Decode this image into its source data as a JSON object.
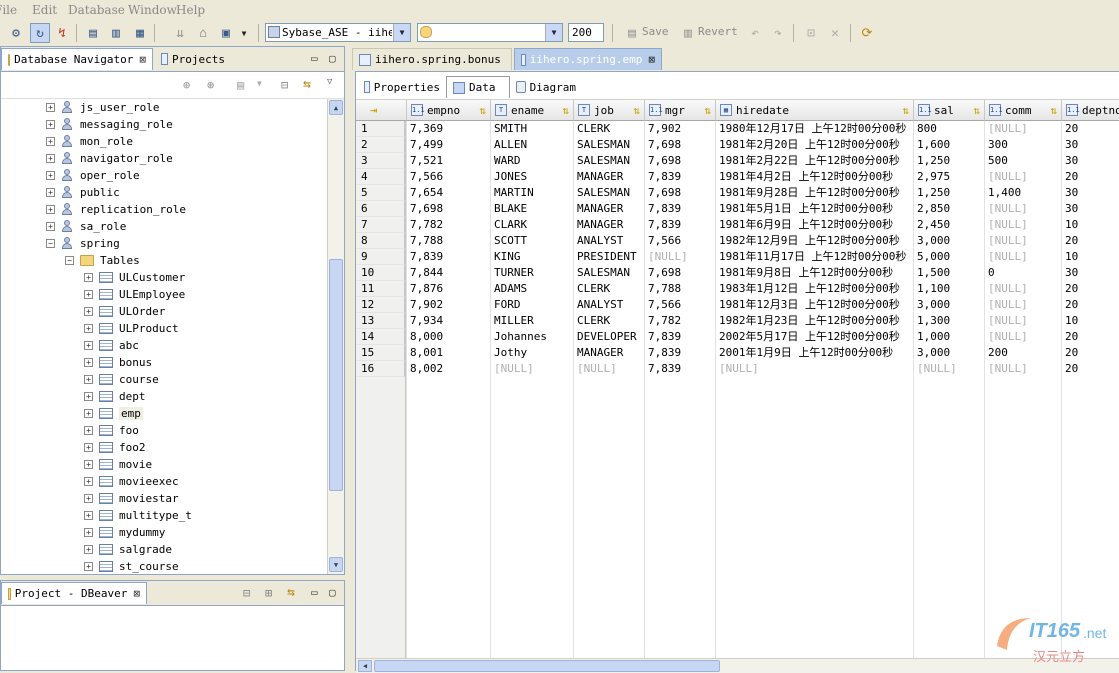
{
  "menu": [
    "File",
    "Edit",
    "Database",
    "Window",
    "Help"
  ],
  "toolbar": {
    "datasource": "Sybase_ASE - iihero",
    "schema": "",
    "max_rows": "200",
    "save_label": "Save",
    "revert_label": "Revert"
  },
  "navigator": {
    "tab_label": "Database Navigator",
    "projects_tab_label": "Projects",
    "roles": [
      "js_user_role",
      "messaging_role",
      "mon_role",
      "navigator_role",
      "oper_role",
      "public",
      "replication_role",
      "sa_role",
      "spring"
    ],
    "folder_label": "Tables",
    "tables": [
      "ULCustomer",
      "ULEmployee",
      "ULOrder",
      "ULProduct",
      "abc",
      "bonus",
      "course",
      "dept",
      "emp",
      "foo",
      "foo2",
      "movie",
      "movieexec",
      "moviestar",
      "multitype_t",
      "mydummy",
      "salgrade",
      "st_course"
    ],
    "selected_table": "emp"
  },
  "project_panel": {
    "tab_label": "Project - DBeaver"
  },
  "editor": {
    "tabs": [
      "iihero.spring.bonus",
      "iihero.spring.emp"
    ],
    "active_tab": "iihero.spring.emp",
    "subtabs": [
      "Properties",
      "Data",
      "Diagram"
    ],
    "active_subtab": "Data"
  },
  "grid": {
    "columns": [
      "empno",
      "ename",
      "job",
      "mgr",
      "hiredate",
      "sal",
      "comm",
      "deptno"
    ],
    "column_type_icons": [
      "1.1",
      "T",
      "T",
      "1.1",
      "dt",
      "1.1",
      "1.1",
      "1.1"
    ],
    "rows": [
      [
        "1",
        "7,369",
        "SMITH",
        "CLERK",
        "7,902",
        "1980年12月17日 上午12时00分00秒",
        "800",
        "[NULL]",
        "20"
      ],
      [
        "2",
        "7,499",
        "ALLEN",
        "SALESMAN",
        "7,698",
        "1981年2月20日 上午12时00分00秒",
        "1,600",
        "300",
        "30"
      ],
      [
        "3",
        "7,521",
        "WARD",
        "SALESMAN",
        "7,698",
        "1981年2月22日 上午12时00分00秒",
        "1,250",
        "500",
        "30"
      ],
      [
        "4",
        "7,566",
        "JONES",
        "MANAGER",
        "7,839",
        "1981年4月2日 上午12时00分00秒",
        "2,975",
        "[NULL]",
        "20"
      ],
      [
        "5",
        "7,654",
        "MARTIN",
        "SALESMAN",
        "7,698",
        "1981年9月28日 上午12时00分00秒",
        "1,250",
        "1,400",
        "30"
      ],
      [
        "6",
        "7,698",
        "BLAKE",
        "MANAGER",
        "7,839",
        "1981年5月1日 上午12时00分00秒",
        "2,850",
        "[NULL]",
        "30"
      ],
      [
        "7",
        "7,782",
        "CLARK",
        "MANAGER",
        "7,839",
        "1981年6月9日 上午12时00分00秒",
        "2,450",
        "[NULL]",
        "10"
      ],
      [
        "8",
        "7,788",
        "SCOTT",
        "ANALYST",
        "7,566",
        "1982年12月9日 上午12时00分00秒",
        "3,000",
        "[NULL]",
        "20"
      ],
      [
        "9",
        "7,839",
        "KING",
        "PRESIDENT",
        "[NULL]",
        "1981年11月17日 上午12时00分00秒",
        "5,000",
        "[NULL]",
        "10"
      ],
      [
        "10",
        "7,844",
        "TURNER",
        "SALESMAN",
        "7,698",
        "1981年9月8日 上午12时00分00秒",
        "1,500",
        "0",
        "30"
      ],
      [
        "11",
        "7,876",
        "ADAMS",
        "CLERK",
        "7,788",
        "1983年1月12日 上午12时00分00秒",
        "1,100",
        "[NULL]",
        "20"
      ],
      [
        "12",
        "7,902",
        "FORD",
        "ANALYST",
        "7,566",
        "1981年12月3日 上午12时00分00秒",
        "3,000",
        "[NULL]",
        "20"
      ],
      [
        "13",
        "7,934",
        "MILLER",
        "CLERK",
        "7,782",
        "1982年1月23日 上午12时00分00秒",
        "1,300",
        "[NULL]",
        "10"
      ],
      [
        "14",
        "8,000",
        "Johannes",
        "DEVELOPER",
        "7,839",
        "2002年5月17日 上午12时00分00秒",
        "1,000",
        "[NULL]",
        "20"
      ],
      [
        "15",
        "8,001",
        "Jothy",
        "MANAGER",
        "7,839",
        "2001年1月9日 上午12时00分00秒",
        "3,000",
        "200",
        "20"
      ],
      [
        "16",
        "8,002",
        "[NULL]",
        "[NULL]",
        "7,839",
        "[NULL]",
        "[NULL]",
        "[NULL]",
        "20"
      ]
    ]
  },
  "watermark": {
    "brand": "IT165",
    "suffix": ".net",
    "cn": "汉元立方"
  },
  "colors": {
    "panel_border": "#8fa6c8",
    "null_text": "#b0b0b0",
    "chrome": "#ece9d8",
    "accent": "#b8cdea"
  }
}
